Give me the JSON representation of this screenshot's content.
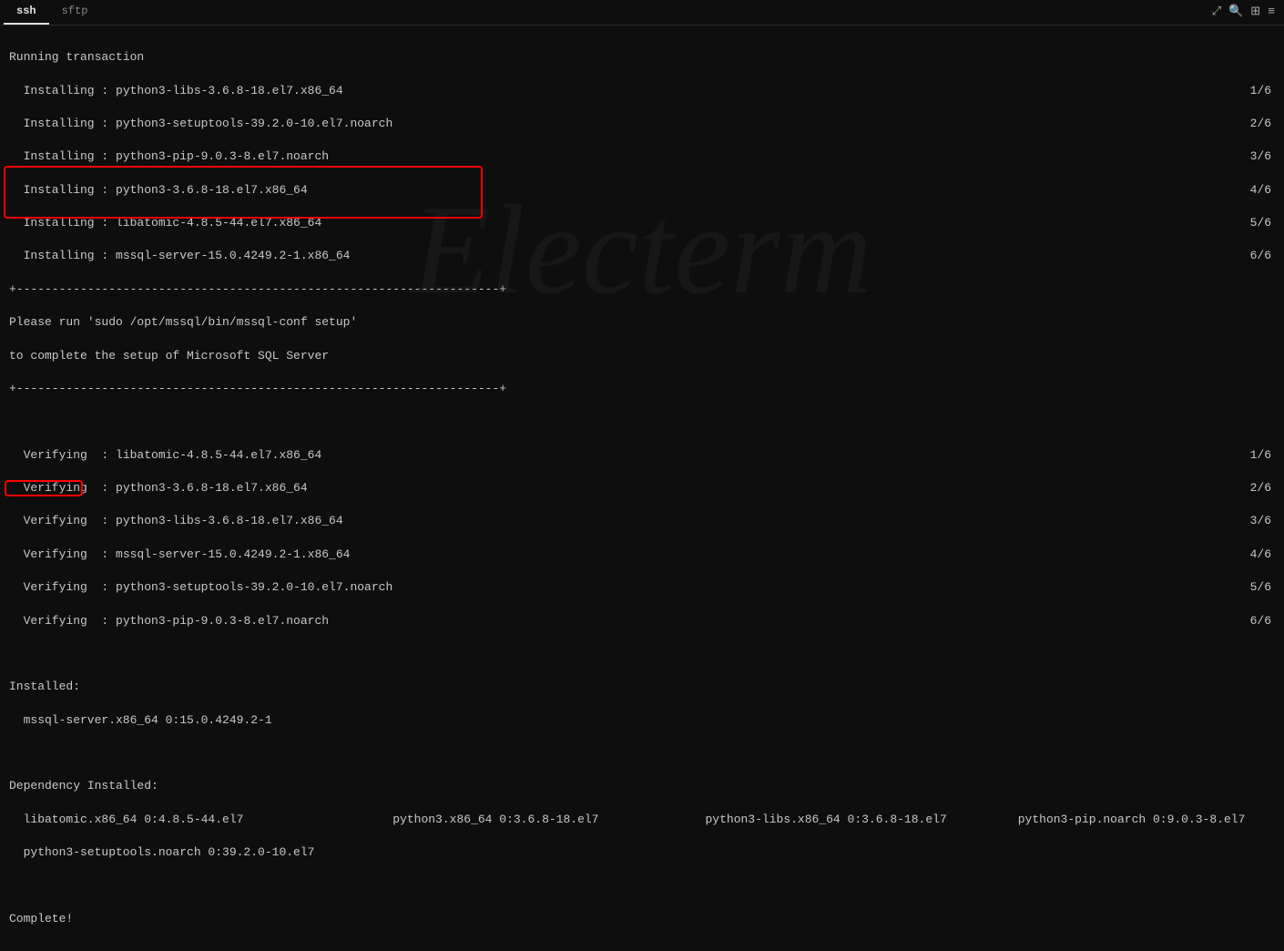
{
  "tabs": {
    "ssh": "ssh",
    "sftp": "sftp"
  },
  "toolbar": {
    "fullscreen": "⤢",
    "search": "🔍",
    "layout1": "⊞",
    "layout2": "≡"
  },
  "watermark": "Electerm",
  "terminal": {
    "running": "Running transaction",
    "installing_label": "Installing : ",
    "verifying_label": "Verifying  : ",
    "install": [
      {
        "pkg": "python3-libs-3.6.8-18.el7.x86_64",
        "count": "1/6"
      },
      {
        "pkg": "python3-setuptools-39.2.0-10.el7.noarch",
        "count": "2/6"
      },
      {
        "pkg": "python3-pip-9.0.3-8.el7.noarch",
        "count": "3/6"
      },
      {
        "pkg": "python3-3.6.8-18.el7.x86_64",
        "count": "4/6"
      },
      {
        "pkg": "libatomic-4.8.5-44.el7.x86_64",
        "count": "5/6"
      },
      {
        "pkg": "mssql-server-15.0.4249.2-1.x86_64",
        "count": "6/6"
      }
    ],
    "rule_top": "+--------------------------------------------------------------------+",
    "notice1": "Please run 'sudo /opt/mssql/bin/mssql-conf setup'",
    "notice2": "to complete the setup of Microsoft SQL Server",
    "rule_bot": "+--------------------------------------------------------------------+",
    "verify": [
      {
        "pkg": "libatomic-4.8.5-44.el7.x86_64",
        "count": "1/6"
      },
      {
        "pkg": "python3-3.6.8-18.el7.x86_64",
        "count": "2/6"
      },
      {
        "pkg": "python3-libs-3.6.8-18.el7.x86_64",
        "count": "3/6"
      },
      {
        "pkg": "mssql-server-15.0.4249.2-1.x86_64",
        "count": "4/6"
      },
      {
        "pkg": "python3-setuptools-39.2.0-10.el7.noarch",
        "count": "5/6"
      },
      {
        "pkg": "python3-pip-9.0.3-8.el7.noarch",
        "count": "6/6"
      }
    ],
    "installed_header": "Installed:",
    "installed_pkg": "mssql-server.x86_64 0:15.0.4249.2-1",
    "dep_header": "Dependency Installed:",
    "deps_row1_a": "libatomic.x86_64 0:4.8.5-44.el7",
    "deps_row1_b": "python3.x86_64 0:3.6.8-18.el7",
    "deps_row1_c": "python3-libs.x86_64 0:3.6.8-18.el7",
    "deps_row1_d": "python3-pip.noarch 0:9.0.3-8.el7",
    "deps_row2_a": "python3-setuptools.noarch 0:39.2.0-10.el7",
    "complete": "Complete!"
  }
}
